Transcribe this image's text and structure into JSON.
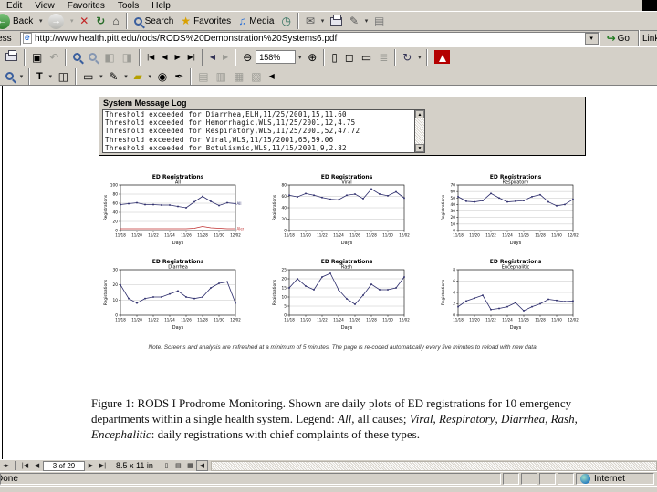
{
  "menu_bar": {
    "items": [
      "Edit",
      "View",
      "Favorites",
      "Tools",
      "Help"
    ]
  },
  "ie_toolbar": {
    "back_label": "Back",
    "search_label": "Search",
    "favorites_label": "Favorites",
    "media_label": "Media"
  },
  "address_bar": {
    "label": "Address",
    "url": "http://www.health.pitt.edu/rods/RODS%20Demonstration%20Systems6.pdf",
    "go_label": "Go",
    "links_label": "Links"
  },
  "pdf_toolbar": {
    "zoom_level": "158%"
  },
  "pdf_page": {
    "log_window": {
      "title": "System Message Log",
      "lines": [
        "Threshold exceeded for Diarrhea,ELH,11/25/2001,15,11.60",
        "Threshold exceeded for Hemorrhagic,WLS,11/25/2001,12,4.75",
        "Threshold exceeded for Respiratory,WLS,11/25/2001,52,47.72",
        "Threshold exceeded for Viral,WLS,11/15/2001,65,59.06",
        "Threshold exceeded for Botulismic,WLS,11/15/2001,9,2.82"
      ]
    },
    "note": "Note: Screens and analysis are refreshed at a minimum of 5 minutes. The page is re-coded automatically every five minutes to reload with new data.",
    "caption": {
      "segments": [
        {
          "text": "Figure 1:  RODS I Prodrome Monitoring.  Shown are daily plots of ED registrations for 10 emergency departments within a single health system.  Legend: ",
          "italic": false
        },
        {
          "text": "All",
          "italic": true
        },
        {
          "text": ", all causes; ",
          "italic": false
        },
        {
          "text": "Viral",
          "italic": true
        },
        {
          "text": ", ",
          "italic": false
        },
        {
          "text": "Respiratory",
          "italic": true
        },
        {
          "text": ", ",
          "italic": false
        },
        {
          "text": "Diarrhea",
          "italic": true
        },
        {
          "text": ", ",
          "italic": false
        },
        {
          "text": "Rash",
          "italic": true
        },
        {
          "text": ", ",
          "italic": false
        },
        {
          "text": "Encephalitic",
          "italic": true
        },
        {
          "text": ": daily registrations with chief complaints of these types.",
          "italic": false
        }
      ]
    }
  },
  "pdf_status_bar": {
    "page_indicator": "3 of 29",
    "page_size": "8.5 x 11 in"
  },
  "ie_status_bar": {
    "status": "Done",
    "zone": "Internet"
  },
  "icons": {
    "back": "←",
    "forward": "→",
    "stop": "✕",
    "refresh": "↻",
    "home": "⌂",
    "favorites": "★",
    "media": "♫",
    "history": "◷",
    "mail": "✉",
    "edit": "✎",
    "discuss": "▤",
    "dropdown": "▾",
    "go": "↪",
    "snapshot": "▣",
    "undo": "↶",
    "prev_page_icon": "◧",
    "next_page_icon": "◨",
    "nav_first": "|◀",
    "nav_prev": "◀",
    "nav_next": "▶",
    "nav_last": "▶|",
    "view_back": "◀",
    "view_forward": "▶",
    "zoom_out": "⊖",
    "zoom_in": "⊕",
    "fit_actual": "▯",
    "fit_page": "◻",
    "fit_width": "▭",
    "fit_reflow": "≣",
    "rotate": "↻",
    "text_select": "T",
    "camera": "◫",
    "note_tool": "▭",
    "pencil": "✎",
    "highlighter": "▰",
    "stamp": "◉",
    "signature": "✒",
    "panel_1": "▤",
    "panel_2": "▥",
    "panel_3": "▦",
    "panel_4": "▧",
    "collapse_left": "◀",
    "splitter": "◂▸",
    "scroll_up": "▲",
    "scroll_down": "▼"
  },
  "colors": {
    "series_navy": "#2b2b6b",
    "series_red": "#c03030",
    "window_gray": "#d4d0c8"
  },
  "chart_data": [
    {
      "type": "line",
      "title": "ED Registrations",
      "subtitle": "All",
      "xlabel": "Days",
      "ylabel": "Registrations",
      "x_ticks": [
        "11/18",
        "11/20",
        "11/22",
        "11/24",
        "11/26",
        "11/28",
        "11/30",
        "12/02"
      ],
      "ylim": [
        0,
        100
      ],
      "y_ticks": [
        0,
        20,
        40,
        60,
        80,
        100
      ],
      "grid": true,
      "series": [
        {
          "name": "All",
          "color": "#2b2b6b",
          "end_label": "All",
          "values": [
            57,
            59,
            61,
            57,
            57,
            56,
            56,
            53,
            50,
            63,
            75,
            64,
            55,
            61,
            59
          ]
        },
        {
          "name": "Alert",
          "color": "#c03030",
          "end_label": "Alert",
          "values": [
            4,
            4,
            4,
            4,
            4,
            4,
            4,
            4,
            4,
            5,
            9,
            6,
            5,
            4,
            4
          ]
        }
      ]
    },
    {
      "type": "line",
      "title": "ED Registrations",
      "subtitle": "Viral",
      "xlabel": "Days",
      "ylabel": "Registrations",
      "x_ticks": [
        "11/18",
        "11/20",
        "11/22",
        "11/24",
        "11/26",
        "11/28",
        "11/30",
        "12/02"
      ],
      "ylim": [
        0,
        80
      ],
      "y_ticks": [
        0,
        20,
        40,
        60,
        80
      ],
      "grid": true,
      "series": [
        {
          "name": "Viral",
          "color": "#2b2b6b",
          "values": [
            62,
            59,
            65,
            62,
            58,
            55,
            54,
            62,
            64,
            56,
            73,
            64,
            61,
            68,
            57
          ]
        }
      ]
    },
    {
      "type": "line",
      "title": "ED Registrations",
      "subtitle": "Respiratory",
      "xlabel": "Days",
      "ylabel": "Registrations",
      "x_ticks": [
        "11/18",
        "11/20",
        "11/22",
        "11/24",
        "11/26",
        "11/28",
        "11/30",
        "12/02"
      ],
      "ylim": [
        0,
        70
      ],
      "y_ticks": [
        0,
        10,
        20,
        30,
        40,
        50,
        60,
        70
      ],
      "grid": true,
      "series": [
        {
          "name": "Respiratory",
          "color": "#2b2b6b",
          "values": [
            52,
            45,
            44,
            46,
            57,
            50,
            44,
            45,
            46,
            52,
            55,
            44,
            38,
            40,
            48
          ]
        }
      ]
    },
    {
      "type": "line",
      "title": "ED Registrations",
      "subtitle": "Diarrhea",
      "xlabel": "Days",
      "ylabel": "Registrations",
      "x_ticks": [
        "11/18",
        "11/20",
        "11/22",
        "11/24",
        "11/26",
        "11/28",
        "11/30",
        "12/02"
      ],
      "ylim": [
        0,
        30
      ],
      "y_ticks": [
        0,
        10,
        20,
        30
      ],
      "grid": true,
      "series": [
        {
          "name": "Diarrhea",
          "color": "#2b2b6b",
          "values": [
            20,
            11,
            8,
            11,
            12,
            12,
            14,
            16,
            12,
            11,
            12,
            18,
            21,
            22,
            8
          ]
        }
      ]
    },
    {
      "type": "line",
      "title": "ED Registrations",
      "subtitle": "Rash",
      "xlabel": "Days",
      "ylabel": "Registrations",
      "x_ticks": [
        "11/18",
        "11/20",
        "11/22",
        "11/24",
        "11/26",
        "11/28",
        "11/30",
        "12/02"
      ],
      "ylim": [
        0,
        25
      ],
      "y_ticks": [
        0,
        5,
        10,
        15,
        20,
        25
      ],
      "grid": true,
      "series": [
        {
          "name": "Rash",
          "color": "#2b2b6b",
          "values": [
            15,
            20,
            16,
            14,
            21,
            23,
            14,
            9,
            6,
            11,
            17,
            14,
            14,
            15,
            21
          ]
        }
      ]
    },
    {
      "type": "line",
      "title": "ED Registrations",
      "subtitle": "Encephalitic",
      "xlabel": "Days",
      "ylabel": "Registrations",
      "x_ticks": [
        "11/18",
        "11/20",
        "11/22",
        "11/24",
        "11/26",
        "11/28",
        "11/30",
        "12/02"
      ],
      "ylim": [
        0,
        8
      ],
      "y_ticks": [
        0,
        2,
        4,
        6,
        8
      ],
      "grid": true,
      "series": [
        {
          "name": "Encephalitic",
          "color": "#2b2b6b",
          "values": [
            1.5,
            2.5,
            3,
            3.5,
            1,
            1.2,
            1.5,
            2.2,
            0.8,
            1.5,
            2,
            2.8,
            2.6,
            2.4,
            2.5
          ]
        }
      ]
    }
  ]
}
